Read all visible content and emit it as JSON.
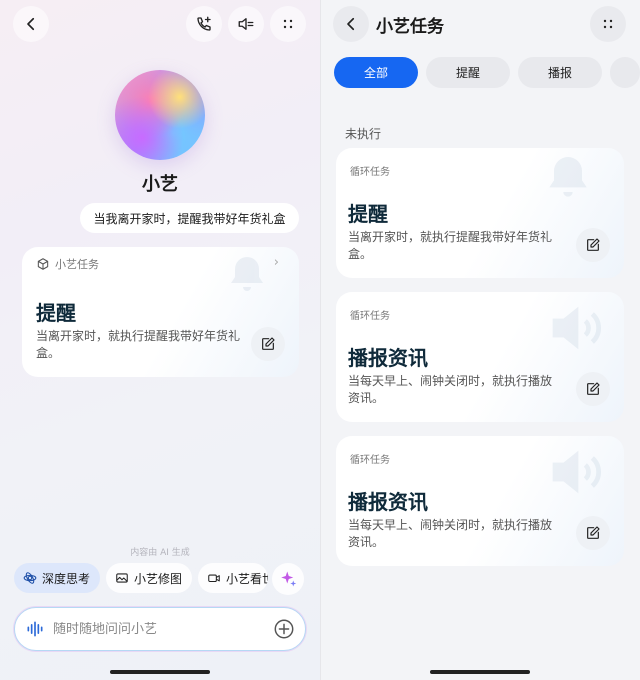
{
  "left": {
    "avatar_name": "小艺",
    "user_message": "当我离开家时，提醒我带好年货礼盒",
    "task_card": {
      "header": "小艺任务",
      "title": "提醒",
      "description": "当离开家时，就执行提醒我带好年货礼盒。"
    },
    "ai_note": "内容由 AI 生成",
    "chips": [
      {
        "label": "深度思考",
        "icon": "deep-think-icon"
      },
      {
        "label": "小艺修图",
        "icon": "image-edit-icon"
      },
      {
        "label": "小艺看世界",
        "icon": "camera-icon"
      }
    ],
    "input_placeholder": "随时随地问问小艺"
  },
  "right": {
    "title": "小艺任务",
    "tabs": [
      "全部",
      "提醒",
      "播报"
    ],
    "section_label": "未执行",
    "cards": [
      {
        "category": "循环任务",
        "title": "提醒",
        "description": "当离开家时，就执行提醒我带好年货礼盒。"
      },
      {
        "category": "循环任务",
        "title": "播报资讯",
        "description": "当每天早上、闹钟关闭时，就执行播放资讯。"
      },
      {
        "category": "循环任务",
        "title": "播报资讯",
        "description": "当每天早上、闹钟关闭时，就执行播放资讯。"
      }
    ]
  },
  "colors": {
    "accent": "#1667f2",
    "title_text": "#0f2a3a"
  }
}
